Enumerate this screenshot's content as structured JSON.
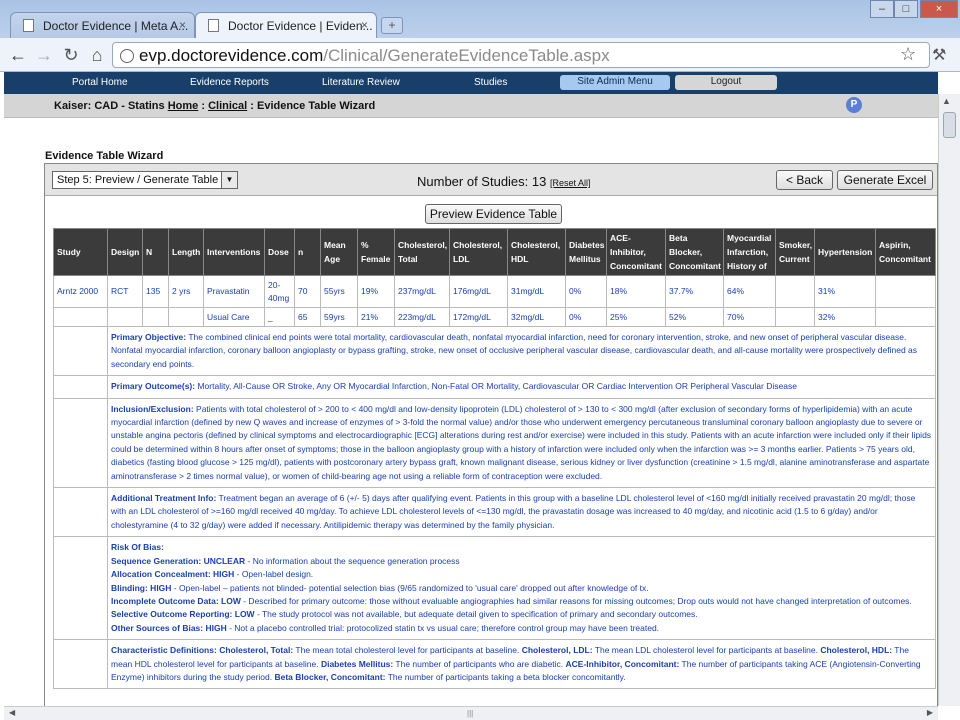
{
  "browser": {
    "tabs": [
      {
        "title": "Doctor Evidence | Meta A..."
      },
      {
        "title": "Doctor Evidence | Eviden..."
      }
    ],
    "close_glyph": "×",
    "new_tab_glyph": "+",
    "url_host": "evp.doctorevidence.com",
    "url_path": "/Clinical/GenerateEvidenceTable.aspx",
    "window_buttons": [
      "–",
      "□",
      "×"
    ]
  },
  "site_nav": {
    "items": [
      "Portal Home",
      "Evidence Reports",
      "Literature Review",
      "Studies"
    ],
    "admin_button": "Site Admin Menu",
    "logout_button": "Logout"
  },
  "breadcrumb": {
    "prefix": "Kaiser: CAD - Statins",
    "home": "Home",
    "sep": ":",
    "clinical": "Clinical",
    "current": "Evidence Table Wizard",
    "help_badge": "P"
  },
  "wizard": {
    "title": "Evidence Table Wizard",
    "step_select": "Step 5: Preview / Generate Table",
    "study_count_label": "Number of Studies: 13",
    "reset_link": "[Reset All]",
    "back_button": "< Back",
    "generate_button": "Generate Excel",
    "preview_button": "Preview Evidence Table"
  },
  "table": {
    "headers": [
      "Study",
      "Design",
      "N",
      "Length",
      "Interventions",
      "Dose",
      "n",
      "Mean Age",
      "% Female",
      "Cholesterol, Total",
      "Cholesterol, LDL",
      "Cholesterol, HDL",
      "Diabetes Mellitus",
      "ACE-Inhibitor, Concomitant",
      "Beta Blocker, Concomitant",
      "Myocardial Infarction, History of",
      "Smoker, Current",
      "Hypertension",
      "Aspirin, Concomitant"
    ],
    "rows": [
      [
        "Arntz 2000",
        "RCT",
        "135",
        "2 yrs",
        "Pravastatin",
        "20-40mg",
        "70",
        "55yrs",
        "19%",
        "237mg/dL",
        "176mg/dL",
        "31mg/dL",
        "0%",
        "18%",
        "37.7%",
        "64%",
        "",
        "31%",
        ""
      ],
      [
        "",
        "",
        "",
        "",
        "Usual Care",
        "_",
        "65",
        "59yrs",
        "21%",
        "223mg/dL",
        "172mg/dL",
        "32mg/dL",
        "0%",
        "25%",
        "52%",
        "70%",
        "",
        "32%",
        ""
      ]
    ],
    "primary_objective_label": "Primary Objective:",
    "primary_objective": "The combined clinical end points were total mortality, cardiovascular death, nonfatal myocardial infarction, need for coronary intervention, stroke, and new onset of peripheral vascular disease. Nonfatal myocardial infarction, coronary balloon angioplasty or bypass grafting, stroke, new onset of occlusive peripheral vascular disease, cardiovascular death, and all-cause mortality were prospectively defined as secondary end points.",
    "primary_outcomes_label": "Primary Outcome(s):",
    "primary_outcomes": "Mortality, All-Cause OR Stroke, Any OR Myocardial Infarction, Non-Fatal OR Mortality, Cardiovascular OR Cardiac Intervention OR Peripheral Vascular Disease",
    "inclusion_label": "Inclusion/Exclusion:",
    "inclusion": "Patients with total cholesterol of > 200 to < 400 mg/dl and low-density lipoprotein (LDL) cholesterol of > 130 to < 300 mg/dl (after exclusion of secondary forms of hyperlipidemia) with an acute myocardial infarction (defined by new Q waves and increase of enzymes of > 3-fold the normal value) and/or those who underwent emergency percutaneous transluminal coronary balloon angioplasty due to severe or unstable angina pectoris (defined by clinical symptoms and electrocardiographic [ECG] alterations during rest and/or exercise) were included in this study. Patients with an acute infarction were included only if their lipids could be determined within 8 hours after onset of symptoms; those in the balloon angioplasty group with a history of infarction were included only when the infarction was >= 3 months earlier. Patients > 75 years old, diabetics (fasting blood glucose > 125 mg/dl), patients with postcoronary artery bypass graft, known malignant disease, serious kidney or liver dysfunction (creatinine > 1.5 mg/dl, alanine aminotransferase and aspartate aminotransferase > 2 times normal value), or women of child-bearing age not using a reliable form of contraception were excluded.",
    "treatment_label": "Additional Treatment Info:",
    "treatment": "Treatment began an average of 6 (+/- 5) days after qualifying event. Patients in this group with a baseline LDL cholesterol level of <160 mg/dl initially received pravastatin 20 mg/dl; those with an LDL cholesterol of >=160 mg/dl received 40 mg/day. To achieve LDL cholesterol levels of <=130 mg/dl, the pravastatin dosage was increased to 40 mg/day, and nicotinic acid (1.5 to 6 g/day) and/or cholestyramine (4 to 32 g/day) were added if necessary. Antilipidemic therapy was determined by the family physician.",
    "risk_label": "Risk Of Bias:",
    "risk_items": [
      {
        "label": "Sequence Generation: UNCLEAR",
        "text": " - No information about the sequence generation process"
      },
      {
        "label": "Allocation Concealment: HIGH",
        "text": " - Open-label design."
      },
      {
        "label": "Blinding: HIGH",
        "text": " - Open-label – patients not blinded- potential selection bias (9/65 randomized to 'usual care' dropped out after knowledge of tx."
      },
      {
        "label": "Incomplete Outcome Data: LOW",
        "text": " - Described for primary outcome: those without evaluable angiographies had similar reasons for missing outcomes; Drop outs would not have changed interpretation of outcomes."
      },
      {
        "label": "Selective Outcome Reporting: LOW",
        "text": " - The study protocol was not available, but adequate detail given to specification of primary and secondary outcomes."
      },
      {
        "label": "Other Sources of Bias: HIGH",
        "text": " - Not a placebo controlled trial: protocolized statin tx vs usual care; therefore control group may have been treated."
      }
    ],
    "char_def_label": "Characteristic Definitions:",
    "char_defs": [
      {
        "label": "Cholesterol, Total:",
        "text": " The mean total cholesterol level for participants at baseline. "
      },
      {
        "label": "Cholesterol, LDL:",
        "text": " The mean LDL cholesterol level for participants at baseline. "
      },
      {
        "label": "Cholesterol, HDL:",
        "text": " The mean HDL cholesterol level for participants at baseline. "
      },
      {
        "label": "Diabetes Mellitus:",
        "text": " The number of participants who are diabetic. "
      },
      {
        "label": "ACE-Inhibitor, Concomitant:",
        "text": " The number of participants taking ACE (Angiotensin-Converting Enzyme) inhibitors during the study period. "
      },
      {
        "label": "Beta Blocker, Concomitant:",
        "text": " The number of participants taking a beta blocker concomitantly."
      }
    ]
  }
}
